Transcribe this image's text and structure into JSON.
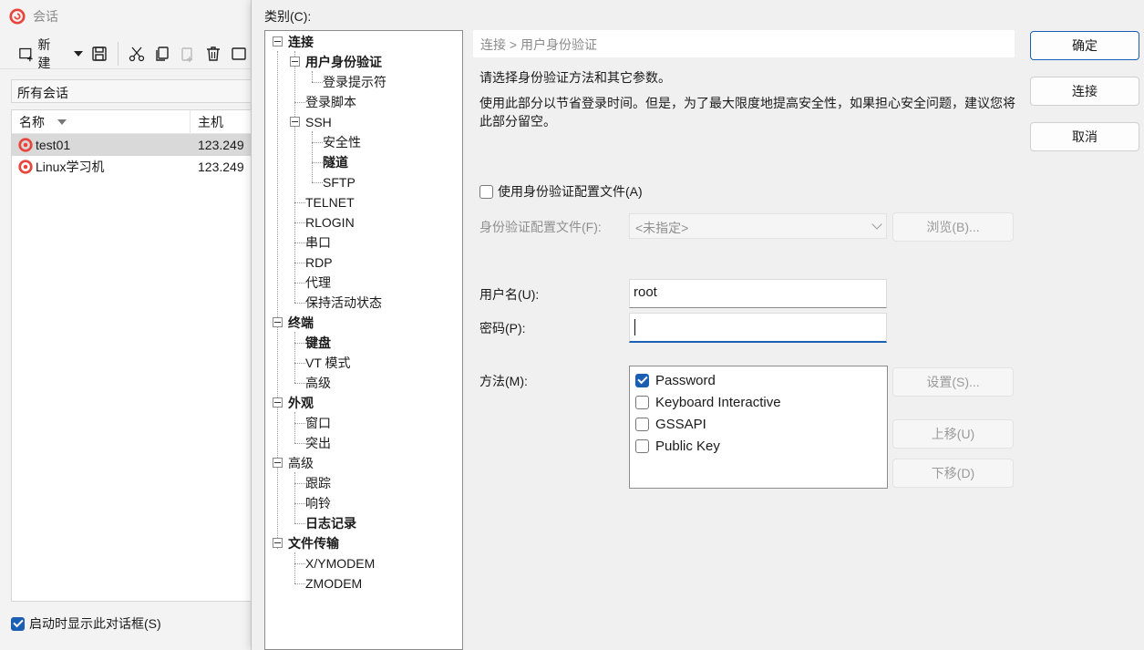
{
  "session_window": {
    "title": "会话",
    "toolbar": {
      "new_label": "新建"
    },
    "filter_text": "所有会话",
    "columns": {
      "name": "名称",
      "host": "主机"
    },
    "sessions": [
      {
        "name": "test01",
        "host": "123.249"
      },
      {
        "name": "Linux学习机",
        "host": "123.249"
      }
    ],
    "startup_label": "启动时显示此对话框(S)",
    "startup_checked": true
  },
  "dialog": {
    "category_label": "类别(C):",
    "tree": {
      "connection": "连接",
      "auth": "用户身份验证",
      "login_prompt": "登录提示符",
      "login_script": "登录脚本",
      "ssh": "SSH",
      "security": "安全性",
      "tunnel": "隧道",
      "sftp": "SFTP",
      "telnet": "TELNET",
      "rlogin": "RLOGIN",
      "serial": "串口",
      "rdp": "RDP",
      "proxy": "代理",
      "keepalive": "保持活动状态",
      "terminal": "终端",
      "keyboard": "键盘",
      "vt_mode": "VT 模式",
      "advanced_term": "高级",
      "appearance": "外观",
      "window": "窗口",
      "highlight": "突出",
      "advanced": "高级",
      "tracing": "跟踪",
      "bell": "响铃",
      "logging": "日志记录",
      "file_transfer": "文件传输",
      "xymodem": "X/YMODEM",
      "zmodem": "ZMODEM"
    },
    "breadcrumb": "连接 > 用户身份验证",
    "desc1": "请选择身份验证方法和其它参数。",
    "desc2": "使用此部分以节省登录时间。但是，为了最大限度地提高安全性，如果担心安全问题，建议您将此部分留空。",
    "use_profile_label": "使用身份验证配置文件(A)",
    "profile_label": "身份验证配置文件(F):",
    "profile_value": "<未指定>",
    "browse_label": "浏览(B)...",
    "username_label": "用户名(U):",
    "username_value": "root",
    "password_label": "密码(P):",
    "method_label": "方法(M):",
    "methods": [
      {
        "label": "Password",
        "checked": true
      },
      {
        "label": "Keyboard Interactive",
        "checked": false
      },
      {
        "label": "GSSAPI",
        "checked": false
      },
      {
        "label": "Public Key",
        "checked": false
      }
    ],
    "settings_label": "设置(S)...",
    "move_up_label": "上移(U)",
    "move_down_label": "下移(D)",
    "ok_label": "确定",
    "connect_label": "连接",
    "cancel_label": "取消"
  },
  "colors": {
    "accent": "#1a5fb4",
    "logo": "#e8453c"
  }
}
